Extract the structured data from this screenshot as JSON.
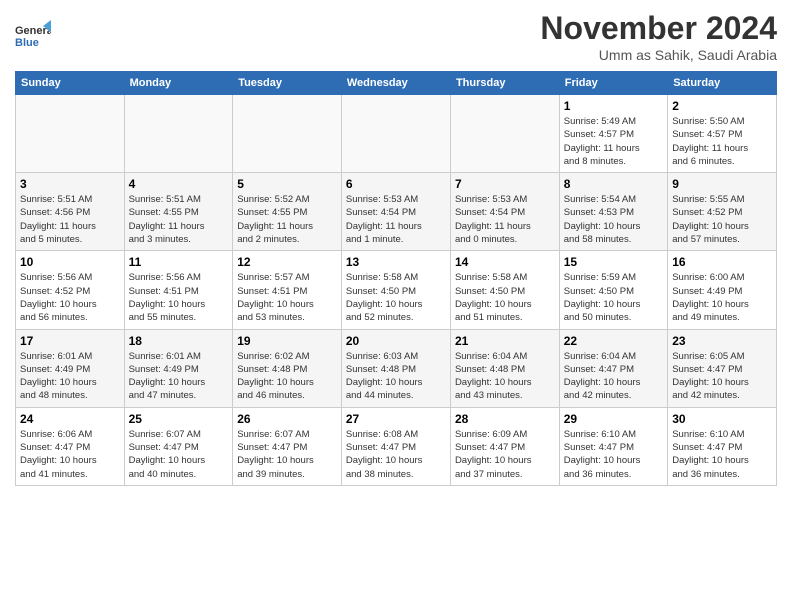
{
  "header": {
    "logo_line1": "General",
    "logo_line2": "Blue",
    "month": "November 2024",
    "location": "Umm as Sahik, Saudi Arabia"
  },
  "weekdays": [
    "Sunday",
    "Monday",
    "Tuesday",
    "Wednesday",
    "Thursday",
    "Friday",
    "Saturday"
  ],
  "weeks": [
    [
      {
        "day": "",
        "info": ""
      },
      {
        "day": "",
        "info": ""
      },
      {
        "day": "",
        "info": ""
      },
      {
        "day": "",
        "info": ""
      },
      {
        "day": "",
        "info": ""
      },
      {
        "day": "1",
        "info": "Sunrise: 5:49 AM\nSunset: 4:57 PM\nDaylight: 11 hours\nand 8 minutes."
      },
      {
        "day": "2",
        "info": "Sunrise: 5:50 AM\nSunset: 4:57 PM\nDaylight: 11 hours\nand 6 minutes."
      }
    ],
    [
      {
        "day": "3",
        "info": "Sunrise: 5:51 AM\nSunset: 4:56 PM\nDaylight: 11 hours\nand 5 minutes."
      },
      {
        "day": "4",
        "info": "Sunrise: 5:51 AM\nSunset: 4:55 PM\nDaylight: 11 hours\nand 3 minutes."
      },
      {
        "day": "5",
        "info": "Sunrise: 5:52 AM\nSunset: 4:55 PM\nDaylight: 11 hours\nand 2 minutes."
      },
      {
        "day": "6",
        "info": "Sunrise: 5:53 AM\nSunset: 4:54 PM\nDaylight: 11 hours\nand 1 minute."
      },
      {
        "day": "7",
        "info": "Sunrise: 5:53 AM\nSunset: 4:54 PM\nDaylight: 11 hours\nand 0 minutes."
      },
      {
        "day": "8",
        "info": "Sunrise: 5:54 AM\nSunset: 4:53 PM\nDaylight: 10 hours\nand 58 minutes."
      },
      {
        "day": "9",
        "info": "Sunrise: 5:55 AM\nSunset: 4:52 PM\nDaylight: 10 hours\nand 57 minutes."
      }
    ],
    [
      {
        "day": "10",
        "info": "Sunrise: 5:56 AM\nSunset: 4:52 PM\nDaylight: 10 hours\nand 56 minutes."
      },
      {
        "day": "11",
        "info": "Sunrise: 5:56 AM\nSunset: 4:51 PM\nDaylight: 10 hours\nand 55 minutes."
      },
      {
        "day": "12",
        "info": "Sunrise: 5:57 AM\nSunset: 4:51 PM\nDaylight: 10 hours\nand 53 minutes."
      },
      {
        "day": "13",
        "info": "Sunrise: 5:58 AM\nSunset: 4:50 PM\nDaylight: 10 hours\nand 52 minutes."
      },
      {
        "day": "14",
        "info": "Sunrise: 5:58 AM\nSunset: 4:50 PM\nDaylight: 10 hours\nand 51 minutes."
      },
      {
        "day": "15",
        "info": "Sunrise: 5:59 AM\nSunset: 4:50 PM\nDaylight: 10 hours\nand 50 minutes."
      },
      {
        "day": "16",
        "info": "Sunrise: 6:00 AM\nSunset: 4:49 PM\nDaylight: 10 hours\nand 49 minutes."
      }
    ],
    [
      {
        "day": "17",
        "info": "Sunrise: 6:01 AM\nSunset: 4:49 PM\nDaylight: 10 hours\nand 48 minutes."
      },
      {
        "day": "18",
        "info": "Sunrise: 6:01 AM\nSunset: 4:49 PM\nDaylight: 10 hours\nand 47 minutes."
      },
      {
        "day": "19",
        "info": "Sunrise: 6:02 AM\nSunset: 4:48 PM\nDaylight: 10 hours\nand 46 minutes."
      },
      {
        "day": "20",
        "info": "Sunrise: 6:03 AM\nSunset: 4:48 PM\nDaylight: 10 hours\nand 44 minutes."
      },
      {
        "day": "21",
        "info": "Sunrise: 6:04 AM\nSunset: 4:48 PM\nDaylight: 10 hours\nand 43 minutes."
      },
      {
        "day": "22",
        "info": "Sunrise: 6:04 AM\nSunset: 4:47 PM\nDaylight: 10 hours\nand 42 minutes."
      },
      {
        "day": "23",
        "info": "Sunrise: 6:05 AM\nSunset: 4:47 PM\nDaylight: 10 hours\nand 42 minutes."
      }
    ],
    [
      {
        "day": "24",
        "info": "Sunrise: 6:06 AM\nSunset: 4:47 PM\nDaylight: 10 hours\nand 41 minutes."
      },
      {
        "day": "25",
        "info": "Sunrise: 6:07 AM\nSunset: 4:47 PM\nDaylight: 10 hours\nand 40 minutes."
      },
      {
        "day": "26",
        "info": "Sunrise: 6:07 AM\nSunset: 4:47 PM\nDaylight: 10 hours\nand 39 minutes."
      },
      {
        "day": "27",
        "info": "Sunrise: 6:08 AM\nSunset: 4:47 PM\nDaylight: 10 hours\nand 38 minutes."
      },
      {
        "day": "28",
        "info": "Sunrise: 6:09 AM\nSunset: 4:47 PM\nDaylight: 10 hours\nand 37 minutes."
      },
      {
        "day": "29",
        "info": "Sunrise: 6:10 AM\nSunset: 4:47 PM\nDaylight: 10 hours\nand 36 minutes."
      },
      {
        "day": "30",
        "info": "Sunrise: 6:10 AM\nSunset: 4:47 PM\nDaylight: 10 hours\nand 36 minutes."
      }
    ]
  ]
}
